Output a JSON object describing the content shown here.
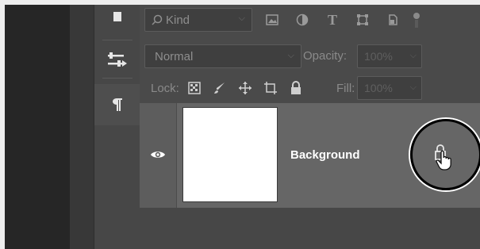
{
  "filter": {
    "kind_label": "Kind",
    "icons": [
      "image-filter-icon",
      "adjustment-filter-icon",
      "type-filter-icon",
      "shape-filter-icon",
      "smart-object-filter-icon",
      "filter-toggle-icon"
    ]
  },
  "blend": {
    "mode": "Normal",
    "opacity_label": "Opacity:",
    "opacity_value": "100%"
  },
  "lock": {
    "label": "Lock:",
    "icons": [
      "lock-transparent-pixels-icon",
      "lock-image-pixels-icon",
      "lock-position-icon",
      "lock-artboard-icon",
      "lock-all-icon"
    ],
    "fill_label": "Fill:",
    "fill_value": "100%"
  },
  "layer": {
    "name": "Background",
    "visible": true,
    "locked": true
  },
  "tools": [
    "tool-icon",
    "adjustments-icon",
    "paragraph-icon"
  ],
  "colors": {
    "panel": "#4a4a4a",
    "selected_row": "#666666",
    "highlight_ring": "#000000"
  }
}
